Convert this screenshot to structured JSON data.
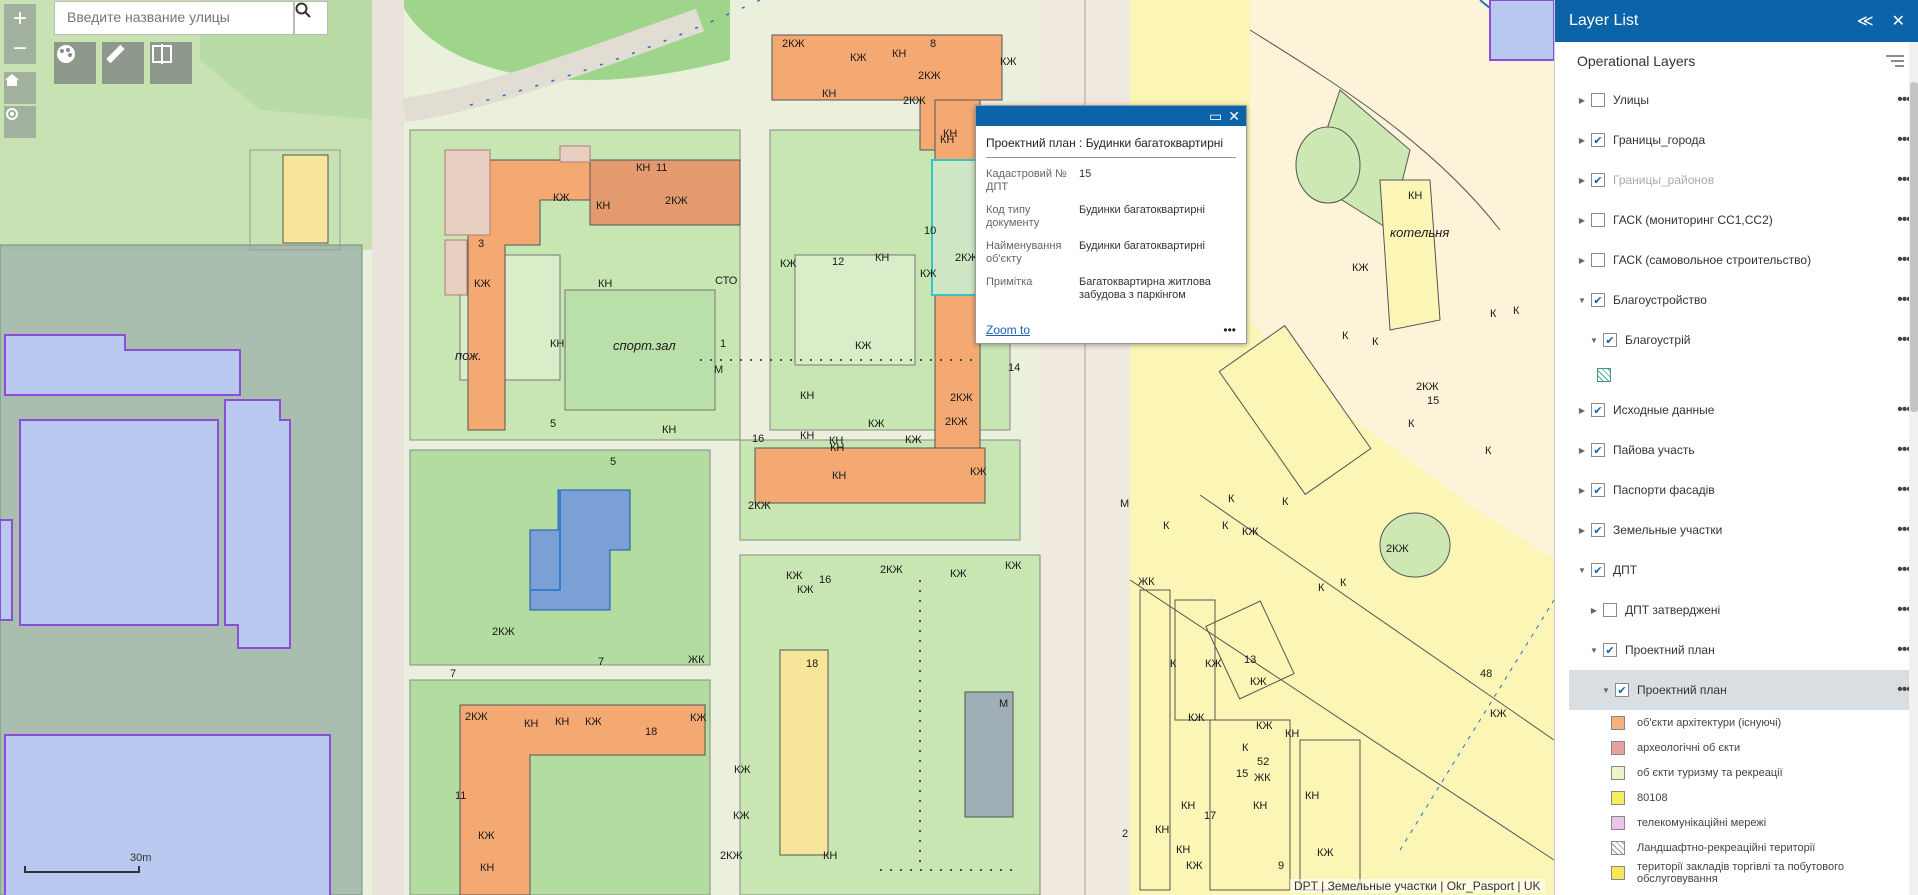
{
  "search": {
    "placeholder": "Введите название улицы"
  },
  "popup": {
    "title": "Проектний план : Будинки багатоквартирні",
    "fields": [
      {
        "key": "Кадастровий № ДПТ",
        "value": "15"
      },
      {
        "key": "Код типу документу",
        "value": "Будинки багатоквартирні"
      },
      {
        "key": "Найменування об'єкту",
        "value": "Будинки багатоквартирні"
      },
      {
        "key": "Примітка",
        "value": "Багатоквартирна житлова забудова з паркінгом"
      }
    ],
    "zoom_label": "Zoom to",
    "more": "•••"
  },
  "attribution": "DPT | Земельные участки | Okr_Pasport | UK",
  "scale": {
    "label": "30m"
  },
  "map_labels": [
    "2КЖ",
    "КЖ",
    "КН",
    "КН",
    "2КЖ",
    "КН",
    "8",
    "КЖ",
    "2КЖ",
    "КН",
    "КЖ",
    "КН",
    "11",
    "КН",
    "КЖ",
    "2КЖ",
    "3",
    "КЖ",
    "КН",
    "КН",
    "СТО",
    "КЖ",
    "12",
    "КН",
    "КЖ",
    "10",
    "2КЖ",
    "спорт.зал",
    "пож.",
    "1",
    "М",
    "КН",
    "КЖ",
    "14",
    "2КЖ",
    "2КЖ",
    "КН",
    "5",
    "КН",
    "КЖ",
    "КН",
    "КН",
    "16",
    "КЖ",
    "КЖ",
    "2КЖ",
    "КН",
    "КН",
    "5",
    "2КЖ",
    "7",
    "ЖК",
    "КЖ",
    "16",
    "2КЖ",
    "КЖ",
    "КЖ",
    "КЖ",
    "7",
    "2КЖ",
    "КН",
    "КН",
    "КЖ",
    "18",
    "КЖ",
    "18",
    "М",
    "КЖ",
    "11",
    "КЖ",
    "КН",
    "2КЖ",
    "КЖ",
    "КН",
    "КЖ",
    "КН",
    "котельня",
    "К",
    "К",
    "К",
    "К",
    "К",
    "2КЖ",
    "15",
    "К",
    "К",
    "К",
    "К",
    "К",
    "КЖ",
    "К",
    "2КЖ",
    "48",
    "КЖ",
    "КЖ",
    "13",
    "КЖ",
    "КЖ",
    "КЖ",
    "КН",
    "52",
    "КН",
    "15",
    "КН",
    "9",
    "КЖ",
    "ЖК",
    "17",
    "КН",
    "КН",
    "КН",
    "К",
    "К",
    "К",
    "М",
    "ЖК",
    "КЖ",
    "2"
  ],
  "layer_list": {
    "title": "Layer List",
    "collapse_icon": "≪",
    "close_icon": "✕",
    "operational": "Operational Layers",
    "layers": [
      {
        "name": "Улицы",
        "checked": false,
        "expanded": false,
        "indent": 0
      },
      {
        "name": "Границы_города",
        "checked": true,
        "expanded": false,
        "indent": 0
      },
      {
        "name": "Границы_районов",
        "checked": true,
        "expanded": false,
        "indent": 0,
        "dim": true
      },
      {
        "name": "ГАСК (мониторинг СС1,СС2)",
        "checked": false,
        "expanded": false,
        "indent": 0
      },
      {
        "name": "ГАСК (самовольное строительство)",
        "checked": false,
        "expanded": false,
        "indent": 0
      },
      {
        "name": "Благоустройство",
        "checked": true,
        "expanded": true,
        "indent": 0
      },
      {
        "name": "Благоустрій",
        "checked": true,
        "expanded": true,
        "indent": 1
      },
      {
        "name": "Исходные данные",
        "checked": true,
        "expanded": false,
        "indent": 0
      },
      {
        "name": "Пайова участь",
        "checked": true,
        "expanded": false,
        "indent": 0
      },
      {
        "name": "Паспорти фасадів",
        "checked": true,
        "expanded": false,
        "indent": 0
      },
      {
        "name": "Земельные участки",
        "checked": true,
        "expanded": false,
        "indent": 0
      },
      {
        "name": "ДПТ",
        "checked": true,
        "expanded": true,
        "indent": 0
      },
      {
        "name": "ДПТ затверджені",
        "checked": false,
        "expanded": false,
        "indent": 1
      },
      {
        "name": "Проектний план",
        "checked": true,
        "expanded": true,
        "indent": 1
      },
      {
        "name": "Проектний план",
        "checked": true,
        "expanded": true,
        "indent": 2,
        "selected": true
      }
    ],
    "legend": [
      {
        "label": "об'єкти архітектури (існуючі)",
        "color": "#f5b27a"
      },
      {
        "label": "археологічні об єкти",
        "color": "#e6a0a0"
      },
      {
        "label": "об єкти туризму та рекреації",
        "color": "#eaf5c9"
      },
      {
        "label": "80108",
        "color": "#f5ef5c"
      },
      {
        "label": "телекомунікаційні мережі",
        "color": "#e9c6e9"
      },
      {
        "label": "Ландшафтно-рекреаційні території",
        "color": "#ffffff"
      },
      {
        "label": "території закладів торгівлі та побутового обслуговування",
        "color": "#f7e85a"
      }
    ]
  }
}
